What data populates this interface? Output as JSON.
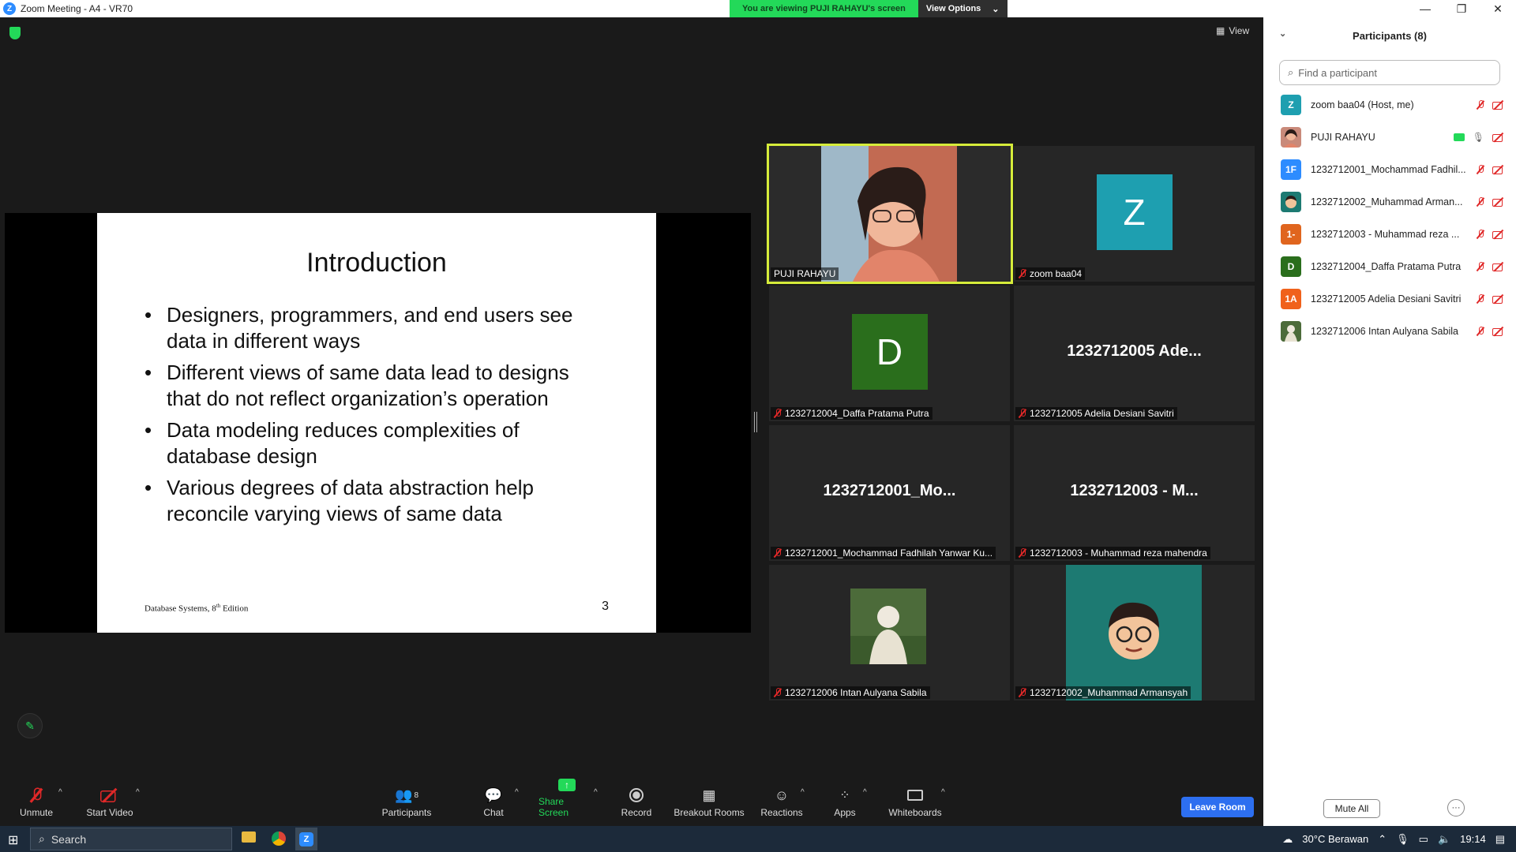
{
  "window": {
    "title": "Zoom Meeting - A4 - VR70"
  },
  "banner": {
    "viewing_text": "You are viewing PUJI RAHAYU's screen",
    "view_options": "View Options"
  },
  "view_button": "View",
  "slide": {
    "title": "Introduction",
    "bullets": [
      "Designers, programmers, and end users see data in different ways",
      "Different views of same data lead to designs that do not reflect organization’s operation",
      "Data modeling reduces complexities of database design",
      "Various degrees of data abstraction help reconcile varying views of same data"
    ],
    "footer_pre": "Database Systems, 8",
    "footer_sup": "th",
    "footer_post": " Edition",
    "page_number": "3"
  },
  "tiles": [
    {
      "name": "PUJI RAHAYU",
      "active": true
    },
    {
      "name": "zoom baa04",
      "initial": "Z",
      "color": "#1e9fb0"
    },
    {
      "name": "1232712004_Daffa Pratama Putra",
      "initial": "D",
      "color": "#2a6e1c"
    },
    {
      "name": "1232712005 Adelia Desiani Savitri",
      "big": "1232712005 Ade..."
    },
    {
      "name": "1232712001_Mochammad Fadhilah Yanwar Ku...",
      "big": "1232712001_Mo..."
    },
    {
      "name": "1232712003 - Muhammad reza mahendra",
      "big": "1232712003 - M..."
    },
    {
      "name": "1232712006 Intan Aulyana Sabila"
    },
    {
      "name": "1232712002_Muhammad Armansyah"
    }
  ],
  "toolbar": {
    "unmute": "Unmute",
    "start_video": "Start Video",
    "participants": "Participants",
    "participants_count": "8",
    "chat": "Chat",
    "share_screen": "Share Screen",
    "record": "Record",
    "breakout": "Breakout Rooms",
    "reactions": "Reactions",
    "apps": "Apps",
    "whiteboards": "Whiteboards",
    "leave": "Leave Room"
  },
  "panel": {
    "title": "Participants (8)",
    "search_placeholder": "Find a participant",
    "participants": [
      {
        "name": "zoom baa04 (Host, me)",
        "initial": "Z",
        "color": "#1e9fb0"
      },
      {
        "name": "PUJI RAHAYU",
        "initial": "",
        "color": "#c98a7a"
      },
      {
        "name": "1232712001_Mochammad Fadhil...",
        "initial": "1F",
        "color": "#2d8cff"
      },
      {
        "name": "1232712002_Muhammad Arman...",
        "initial": "",
        "color": "#1d7a72"
      },
      {
        "name": "1232712003 - Muhammad reza ...",
        "initial": "1-",
        "color": "#e0651e"
      },
      {
        "name": "1232712004_Daffa Pratama Putra",
        "initial": "D",
        "color": "#2a6e1c"
      },
      {
        "name": "1232712005 Adelia Desiani Savitri",
        "initial": "1A",
        "color": "#f0611b"
      },
      {
        "name": "1232712006 Intan Aulyana Sabila",
        "initial": "",
        "color": "#8a8f7a"
      }
    ],
    "mute_all": "Mute All",
    "more": "···"
  },
  "taskbar": {
    "search": "Search",
    "weather": "30°C Berawan",
    "time": "19:14"
  }
}
